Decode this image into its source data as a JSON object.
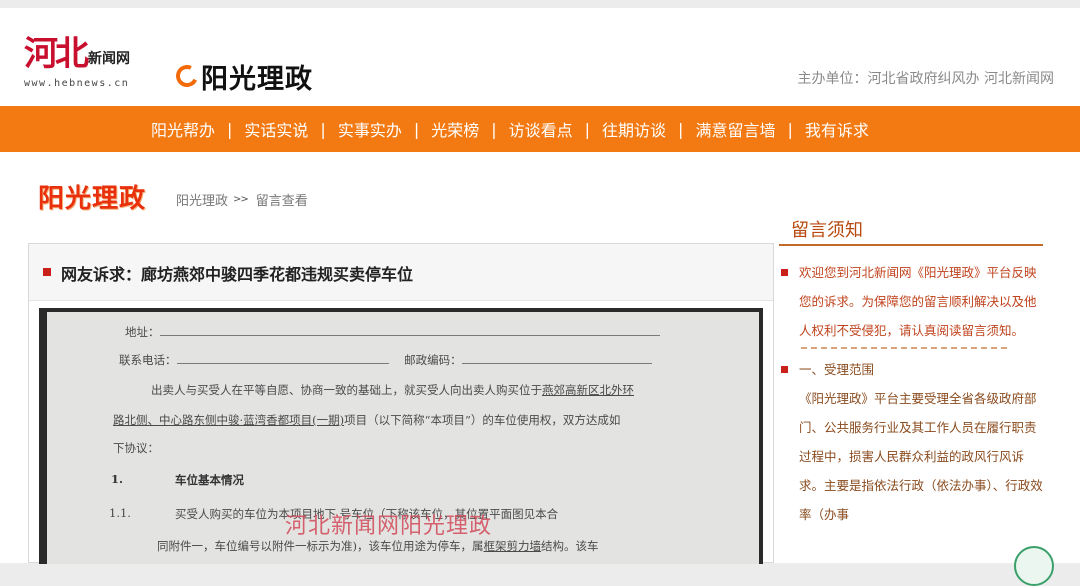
{
  "header": {
    "hebei_logo_main": "河北",
    "hebei_logo_sub": "新闻网",
    "hebei_logo_url": "www.hebnews.cn",
    "sun_logo_text": "阳光理政",
    "sponsor": "主办单位：河北省政府纠风办 河北新闻网"
  },
  "nav": {
    "items": [
      "阳光帮办",
      "实话实说",
      "实事实办",
      "光荣榜",
      "访谈看点",
      "往期访谈",
      "满意留言墙",
      "我有诉求"
    ],
    "separator": "|"
  },
  "breadcrumb": {
    "logo_text": "阳光理政",
    "trail": [
      "阳光理政",
      "留言查看"
    ],
    "arrow": ">>"
  },
  "message": {
    "title": "网友诉求：廊坊燕郊中骏四季花都违规买卖停车位",
    "photo": {
      "line_address": "地址：",
      "line_phone": "联系电话：",
      "line_postcode": "邮政编码：",
      "para1_a": "出卖人与买受人在平等自愿、协商一致的基础上，就买受人向出卖人购买位于",
      "para1_fill": "燕郊高新区北外环",
      "para2_fill": "路北侧、中心路东侧中骏·蓝湾香都项目(一期)",
      "para2_b": "项目（以下简称“本项目”）的车位使用权，双方达成如",
      "para3": "下协议：",
      "sec_num": "1.",
      "sec_title": "车位基本情况",
      "sub_num": "1.1.",
      "sub_text": "买受人购买的车位为本项目地下      号车位（下称该车位，其位置平面图见本合",
      "sub_text2_a": "同附件一，车位编号以附件一标示为准)，该车位用途为停车，属",
      "sub_text2_fill": "框架剪力墙",
      "sub_text2_b": "结构。该车",
      "watermark": "河北新闻网阳光理政"
    }
  },
  "sidebar": {
    "notice_title": "留言须知",
    "intro": "欢迎您到河北新闻网《阳光理政》平台反映您的诉求。为保障您的留言顺利解决以及他人权利不受侵犯，请认真阅读留言须知。",
    "section1_heading": "一、受理范围",
    "section1_body": "《阳光理政》平台主要受理全省各级政府部门、公共服务行业及其工作人员在履行职责过程中，损害人民群众利益的政风行风诉求。主要是指依法行政（依法办事）、行政效率（办事"
  },
  "colors": {
    "nav_bg": "#f37a12",
    "accent_red": "#c9211a",
    "notice_text": "#c0431d"
  }
}
